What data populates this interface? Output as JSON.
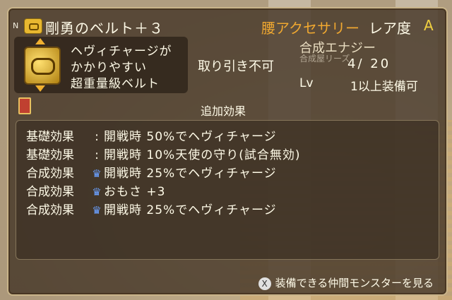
{
  "header": {
    "n_badge": "N",
    "item_name": "剛勇のベルト＋３",
    "category": "腰アクセサリー",
    "rarity_label": "レア度",
    "rarity_value": "A"
  },
  "description": {
    "lines": [
      "ヘヴィチャージが",
      "かかりやすい",
      "超重量級ベルト"
    ]
  },
  "trade_status": "取り引き不可",
  "synthesis": {
    "label": "合成エナジー",
    "sub": "合成屋リーズ",
    "value": "4/ 20"
  },
  "level": {
    "label": "Lv",
    "text": "1以上装備可"
  },
  "effects": {
    "title": "追加効果",
    "rows": [
      {
        "type": "基礎効果",
        "marker": ":",
        "text": "開戦時 50%でヘヴィチャージ"
      },
      {
        "type": "基礎効果",
        "marker": ":",
        "text": "開戦時 10%天使の守り(試合無効)"
      },
      {
        "type": "合成効果",
        "marker": "crown",
        "text": "開戦時 25%でヘヴィチャージ"
      },
      {
        "type": "合成効果",
        "marker": "crown",
        "text": "おもさ +3"
      },
      {
        "type": "合成効果",
        "marker": "crown",
        "text": "開戦時 25%でヘヴィチャージ"
      }
    ]
  },
  "footer": {
    "button_glyph": "X",
    "text": "装備できる仲間モンスターを見る"
  },
  "colors": {
    "category": "#f0a830",
    "rarity": "#f0d040",
    "crown": "#6aa0ff"
  }
}
